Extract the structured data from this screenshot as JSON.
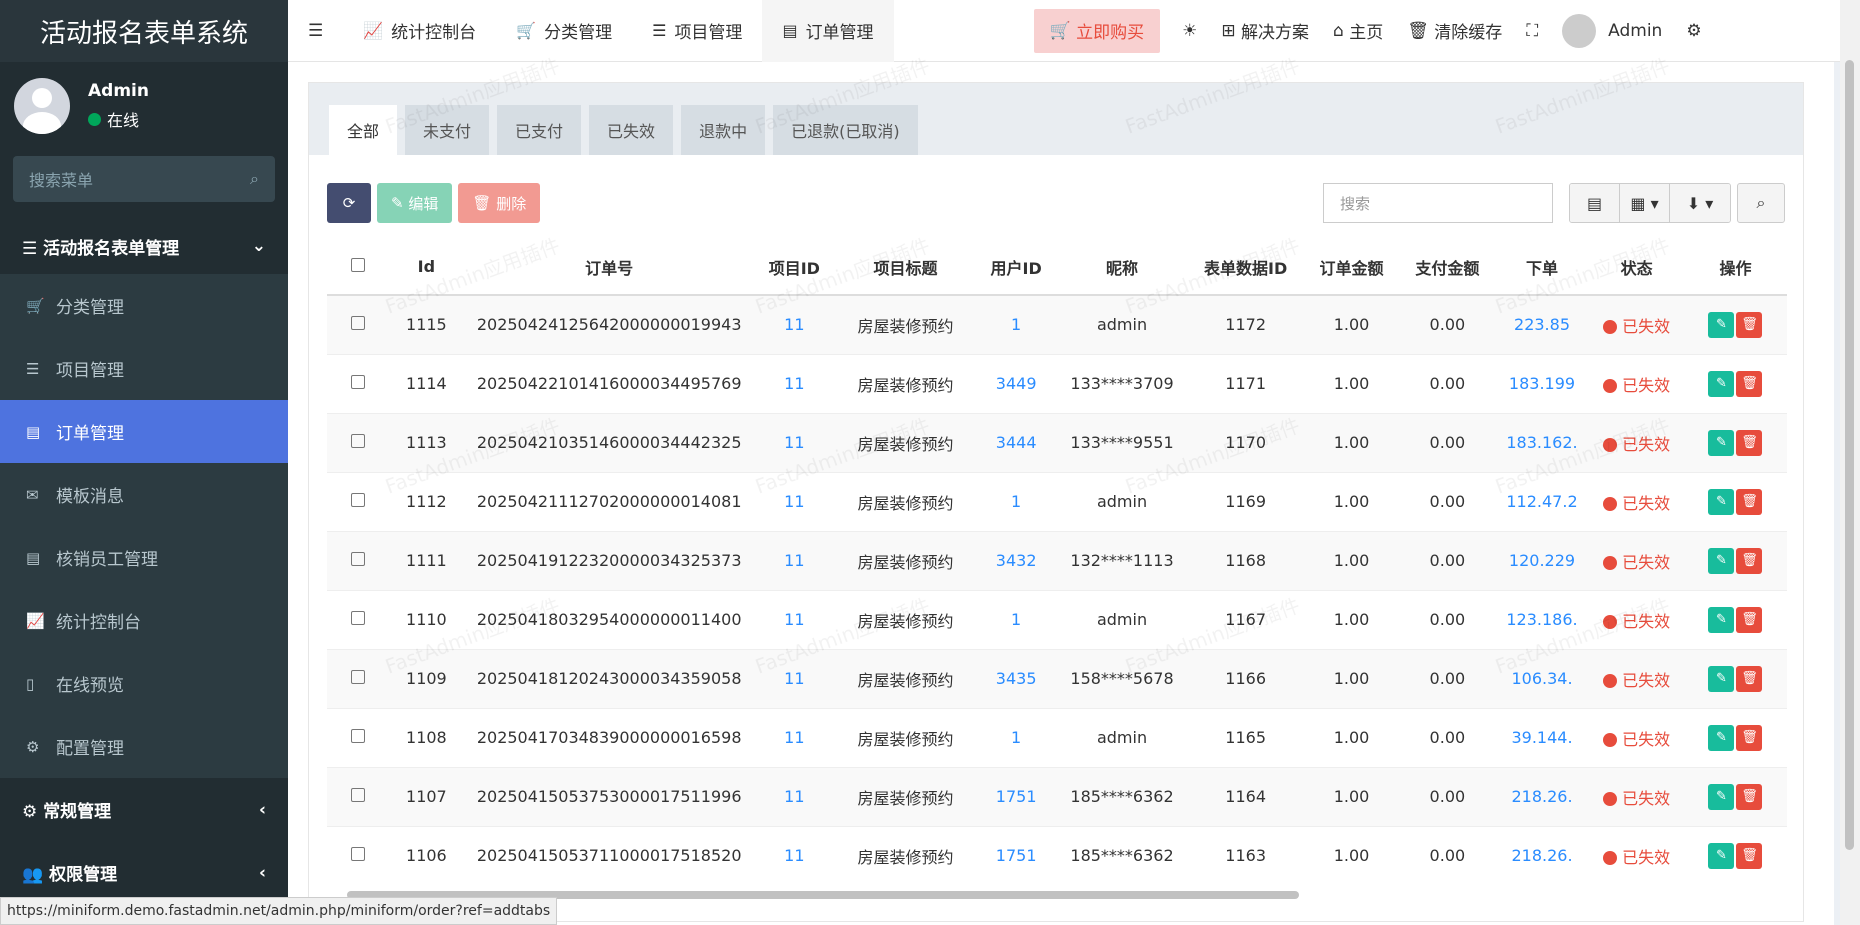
{
  "app": {
    "title": "活动报名表单系统"
  },
  "user": {
    "name": "Admin",
    "status": "在线"
  },
  "sidebar": {
    "search_placeholder": "搜索菜单",
    "group": "活动报名表单管理",
    "items": [
      {
        "label": "分类管理",
        "icon": "cart-icon"
      },
      {
        "label": "项目管理",
        "icon": "list-icon"
      },
      {
        "label": "订单管理",
        "icon": "file-icon"
      },
      {
        "label": "模板消息",
        "icon": "envelope-icon"
      },
      {
        "label": "核销员工管理",
        "icon": "file-icon"
      },
      {
        "label": "统计控制台",
        "icon": "chart-icon"
      },
      {
        "label": "在线预览",
        "icon": "mobile-icon"
      },
      {
        "label": "配置管理",
        "icon": "gears-icon"
      }
    ],
    "groups2": [
      "常规管理",
      "权限管理"
    ]
  },
  "topbar": {
    "tabs": [
      "统计控制台",
      "分类管理",
      "项目管理",
      "订单管理"
    ],
    "buy": "立即购买",
    "solutions": "解决方案",
    "home": "主页",
    "clear_cache": "清除缓存",
    "admin": "Admin"
  },
  "filters": [
    "全部",
    "未支付",
    "已支付",
    "已失效",
    "退款中",
    "已退款(已取消)"
  ],
  "toolbar": {
    "edit": "编辑",
    "delete": "删除",
    "search_placeholder": "搜索"
  },
  "table": {
    "headers": [
      "Id",
      "订单号",
      "项目ID",
      "项目标题",
      "用户ID",
      "昵称",
      "表单数据ID",
      "订单金额",
      "支付金额",
      "下单",
      "状态",
      "操作"
    ],
    "rows": [
      [
        "1115",
        "20250424125642000000019943",
        "11",
        "房屋装修预约",
        "1",
        "admin",
        "1172",
        "1.00",
        "0.00",
        "223.85",
        "已失效"
      ],
      [
        "1114",
        "20250422101416000034495769",
        "11",
        "房屋装修预约",
        "3449",
        "133****3709",
        "1171",
        "1.00",
        "0.00",
        "183.199",
        "已失效"
      ],
      [
        "1113",
        "20250421035146000034442325",
        "11",
        "房屋装修预约",
        "3444",
        "133****9551",
        "1170",
        "1.00",
        "0.00",
        "183.162.",
        "已失效"
      ],
      [
        "1112",
        "20250421112702000000014081",
        "11",
        "房屋装修预约",
        "1",
        "admin",
        "1169",
        "1.00",
        "0.00",
        "112.47.2",
        "已失效"
      ],
      [
        "1111",
        "20250419122320000034325373",
        "11",
        "房屋装修预约",
        "3432",
        "132****1113",
        "1168",
        "1.00",
        "0.00",
        "120.229",
        "已失效"
      ],
      [
        "1110",
        "20250418032954000000011400",
        "11",
        "房屋装修预约",
        "1",
        "admin",
        "1167",
        "1.00",
        "0.00",
        "123.186.",
        "已失效"
      ],
      [
        "1109",
        "20250418120243000034359058",
        "11",
        "房屋装修预约",
        "3435",
        "158****5678",
        "1166",
        "1.00",
        "0.00",
        "106.34.",
        "已失效"
      ],
      [
        "1108",
        "20250417034839000000016598",
        "11",
        "房屋装修预约",
        "1",
        "admin",
        "1165",
        "1.00",
        "0.00",
        "39.144.",
        "已失效"
      ],
      [
        "1107",
        "20250415053753000017511996",
        "11",
        "房屋装修预约",
        "1751",
        "185****6362",
        "1164",
        "1.00",
        "0.00",
        "218.26.",
        "已失效"
      ],
      [
        "1106",
        "20250415053711000017518520",
        "11",
        "房屋装修预约",
        "1751",
        "185****6362",
        "1163",
        "1.00",
        "0.00",
        "218.26.",
        "已失效"
      ]
    ]
  },
  "statusbar": "https://miniform.demo.fastadmin.net/admin.php/miniform/order?ref=addtabs",
  "watermark": "FastAdmin应用插件"
}
